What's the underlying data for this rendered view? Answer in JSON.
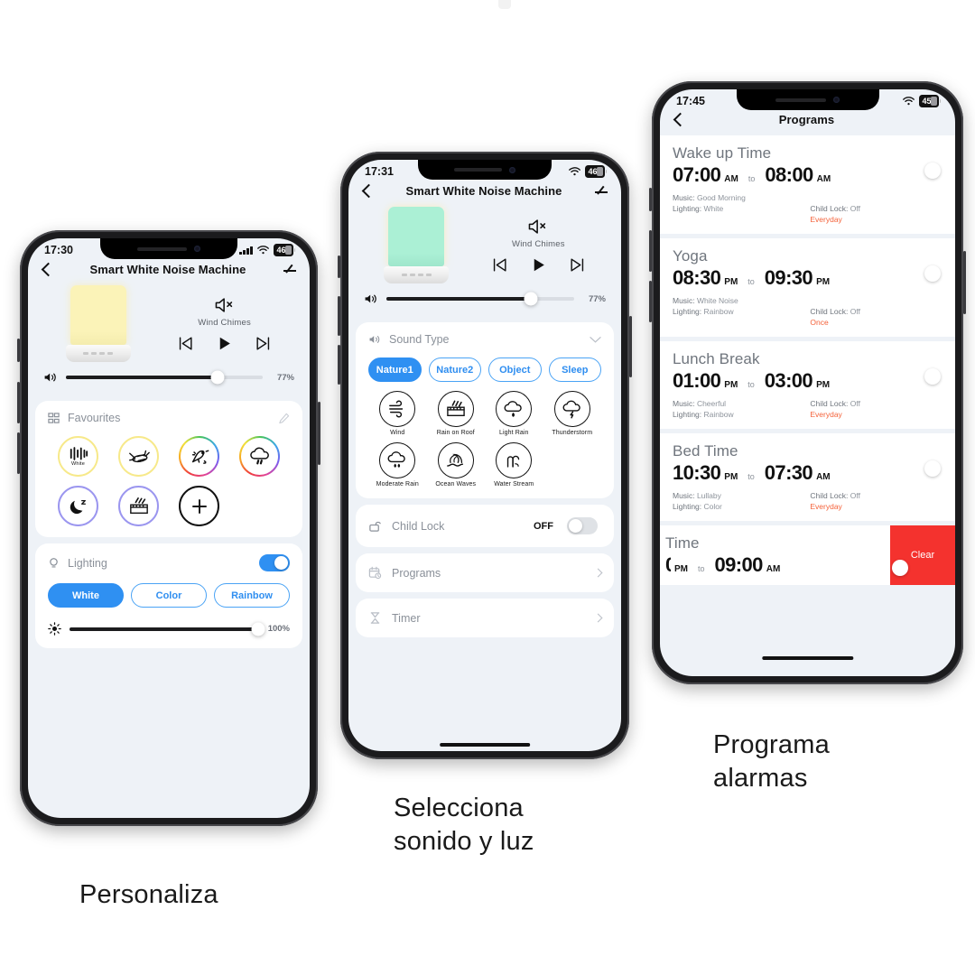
{
  "captions": {
    "left": "Personaliza",
    "middle": "Selecciona\nsonido y luz",
    "right": "Programa\nalarmas"
  },
  "phone1": {
    "status": {
      "time": "17:30",
      "battery": "46",
      "wifi_icon": "wifi-icon",
      "signal_icon": "signal-bars-icon"
    },
    "nav": {
      "back_icon": "chevron-left-icon",
      "title": "Smart White Noise Machine",
      "edit_icon": "pencil-icon"
    },
    "hero": {
      "lamp_color": "#fbf3b8",
      "mute_icon": "speaker-mute-icon",
      "sound_name": "Wind Chimes",
      "prev_icon": "skip-previous-icon",
      "play_icon": "play-icon",
      "next_icon": "skip-next-icon"
    },
    "volume": {
      "icon": "volume-icon",
      "value": "77%",
      "percent": 77
    },
    "favourites": {
      "grid_icon": "grid-icon",
      "title": "Favourites",
      "edit_icon": "pencil-icon",
      "items": [
        {
          "icon": "white-noise-icon",
          "ring": "yellow",
          "sub": "White"
        },
        {
          "icon": "cricket-icon",
          "ring": "yellow",
          "sub": ""
        },
        {
          "icon": "bird-icon",
          "ring": "rainbow",
          "sub": ""
        },
        {
          "icon": "rain-cloud-icon",
          "ring": "rainbow",
          "sub": ""
        },
        {
          "icon": "moon-sleep-icon",
          "ring": "purple",
          "sub": ""
        },
        {
          "icon": "rain-on-roof-icon",
          "ring": "purple",
          "sub": ""
        },
        {
          "icon": "plus-icon",
          "ring": "plain",
          "sub": ""
        }
      ]
    },
    "lighting": {
      "icon": "bulb-icon",
      "title": "Lighting",
      "toggle_state": "on",
      "modes": [
        {
          "label": "White",
          "active": true
        },
        {
          "label": "Color",
          "active": false
        },
        {
          "label": "Rainbow",
          "active": false
        }
      ],
      "brightness": {
        "icon": "brightness-icon",
        "value": "100%",
        "percent": 100
      }
    }
  },
  "phone2": {
    "status": {
      "time": "17:31",
      "battery": "46"
    },
    "nav": {
      "title": "Smart White Noise Machine"
    },
    "hero": {
      "lamp_color": "#abf0d5",
      "sound_name": "Wind Chimes"
    },
    "volume": {
      "value": "77%",
      "percent": 77
    },
    "sound_type": {
      "icon": "speaker-icon",
      "title": "Sound Type",
      "collapse_icon": "chevron-down-icon",
      "tabs": [
        {
          "label": "Nature1",
          "active": true
        },
        {
          "label": "Nature2",
          "active": false
        },
        {
          "label": "Object",
          "active": false
        },
        {
          "label": "Sleep",
          "active": false
        }
      ],
      "sounds": [
        {
          "label": "Wind",
          "icon": "wind-icon"
        },
        {
          "label": "Rain on Roof",
          "icon": "rain-on-roof-icon"
        },
        {
          "label": "Light Rain",
          "icon": "light-rain-icon"
        },
        {
          "label": "Thunderstorm",
          "icon": "thunderstorm-icon"
        },
        {
          "label": "Moderate Rain",
          "icon": "moderate-rain-icon"
        },
        {
          "label": "Ocean Waves",
          "icon": "ocean-waves-icon"
        },
        {
          "label": "Water Stream",
          "icon": "water-stream-icon"
        }
      ]
    },
    "rows": [
      {
        "label": "Child Lock",
        "icon": "lock-icon",
        "value": "OFF",
        "type": "toggle",
        "state": "off"
      },
      {
        "label": "Programs",
        "icon": "calendar-clock-icon",
        "type": "chevron"
      },
      {
        "label": "Timer",
        "icon": "hourglass-icon",
        "type": "chevron"
      }
    ]
  },
  "phone3": {
    "status": {
      "time": "17:45",
      "battery": "45"
    },
    "nav": {
      "title": "Programs",
      "back_icon": "chevron-left-icon"
    },
    "programs": [
      {
        "name": "Wake up Time",
        "start": "07:00",
        "start_ampm": "AM",
        "to": "to",
        "end": "08:00",
        "end_ampm": "AM",
        "music_label": "Music:",
        "music": "Good Morning",
        "lighting_label": "Lighting:",
        "lighting": "White",
        "childlock_label": "Child Lock:",
        "childlock": "Off",
        "repeat": "Everyday",
        "enabled": true
      },
      {
        "name": "Yoga",
        "start": "08:30",
        "start_ampm": "PM",
        "to": "to",
        "end": "09:30",
        "end_ampm": "PM",
        "music_label": "Music:",
        "music": "White Noise",
        "lighting_label": "Lighting:",
        "lighting": "Rainbow",
        "childlock_label": "Child Lock:",
        "childlock": "Off",
        "repeat": "Once",
        "enabled": true
      },
      {
        "name": "Lunch Break",
        "start": "01:00",
        "start_ampm": "PM",
        "to": "to",
        "end": "03:00",
        "end_ampm": "PM",
        "music_label": "Music:",
        "music": "Cheerful",
        "lighting_label": "Lighting:",
        "lighting": "Rainbow",
        "childlock_label": "Child Lock:",
        "childlock": "Off",
        "repeat": "Everyday",
        "enabled": true
      },
      {
        "name": "Bed Time",
        "start": "10:30",
        "start_ampm": "PM",
        "to": "to",
        "end": "07:30",
        "end_ampm": "AM",
        "music_label": "Music:",
        "music": "Lullaby",
        "lighting_label": "Lighting:",
        "lighting": "Color",
        "childlock_label": "Child Lock:",
        "childlock": "Off",
        "repeat": "Everyday",
        "enabled": true
      }
    ],
    "swiped_row": {
      "name": "Time",
      "start_ampm": "PM",
      "to": "to",
      "end": "09:00",
      "end_ampm": "AM",
      "enabled": false,
      "clear_label": "Clear"
    }
  },
  "colors": {
    "accent_blue": "#2f90f2",
    "green": "#2fcc52",
    "red": "#f4322e",
    "orange": "#f4623a",
    "screen_bg": "#eef2f7"
  }
}
